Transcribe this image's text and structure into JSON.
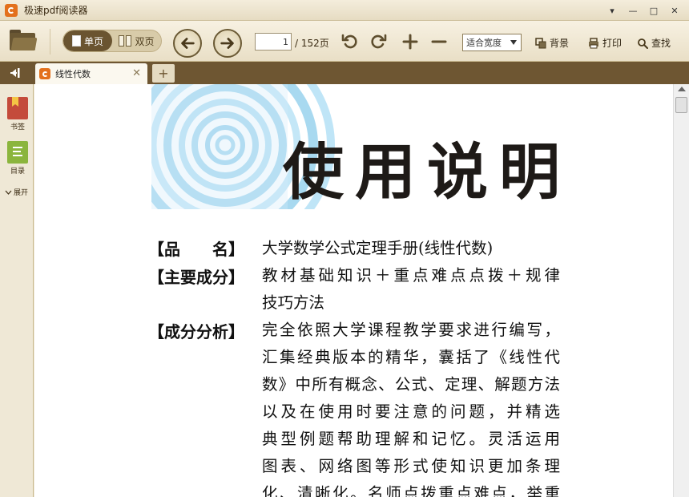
{
  "window": {
    "title": "极速pdf阅读器",
    "controls": [
      "▾",
      "—",
      "□",
      "✕"
    ]
  },
  "toolbar": {
    "single_page": "单页",
    "double_page": "双页",
    "current_page": "1",
    "total_pages": "/ 152页",
    "zoom_mode": "适合宽度",
    "background": "背景",
    "print": "打印",
    "search": "查找"
  },
  "tabs": [
    {
      "label": "线性代数",
      "active": true
    }
  ],
  "sidebar": {
    "bookmarks": "书签",
    "toc": "目录",
    "expand": "展开"
  },
  "document": {
    "title": "使用说明",
    "entries": [
      {
        "key": "【品　　名】",
        "lines": [
          "大学数学公式定理手册(线性代数)"
        ]
      },
      {
        "key": "【主要成分】",
        "lines": [
          "教材基础知识＋重点难点点拨＋规律",
          "技巧方法"
        ]
      },
      {
        "key": "【成分分析】",
        "lines": [
          "完全依照大学课程教学要求进行编写，",
          "汇集经典版本的精华，囊括了《线性代",
          "数》中所有概念、公式、定理、解题方法",
          "以及在使用时要注意的问题，并精选",
          "典型例题帮助理解和记忆。灵活运用",
          "图表、网络图等形式使知识更加条理",
          "化、清晰化。名师点拨重点难点，举重"
        ]
      }
    ]
  },
  "colors": {
    "accent": "#6a5430",
    "tabbar": "#6e5632",
    "banner_ring": "#a8d9f0",
    "logo": "#e3701c"
  }
}
